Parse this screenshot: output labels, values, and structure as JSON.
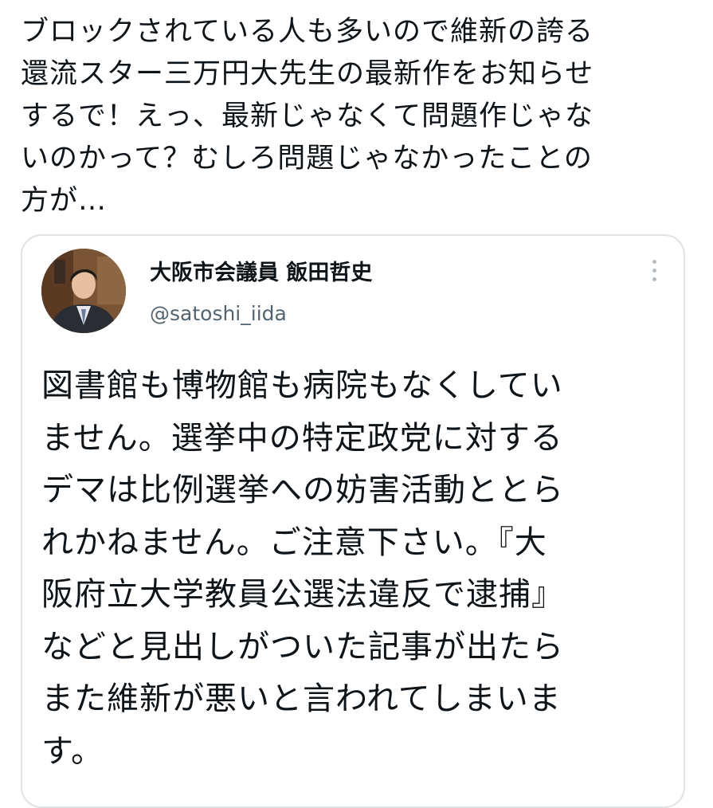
{
  "tweet": {
    "text": "ブロックされている人も多いので維新の誇る\n還流スター三万円大先生の最新作をお知らせ\nするで！えっ、最新じゃなくて問題作じゃな\nいのかって？むしろ問題じゃなかったことの\n方が…"
  },
  "quoted_tweet": {
    "author_name": "大阪市会議員 飯田哲史",
    "author_handle": "@satoshi_iida",
    "avatar_icon": "profile-photo",
    "more_icon": "vertical-ellipsis-icon",
    "text": "図書館も博物館も病院もなくしてい\nません。選挙中の特定政党に対する\nデマは比例選挙への妨害活動ととら\nれかねません。ご注意下さい。『大\n阪府立大学教員公選法違反で逮捕』\nなどと見出しがついた記事が出たら\nまた維新が悪いと言われてしまいま\nす。"
  },
  "colors": {
    "text": "#0f1419",
    "secondary_text": "#536471",
    "card_border": "#dfe3e6",
    "background": "#ffffff"
  }
}
